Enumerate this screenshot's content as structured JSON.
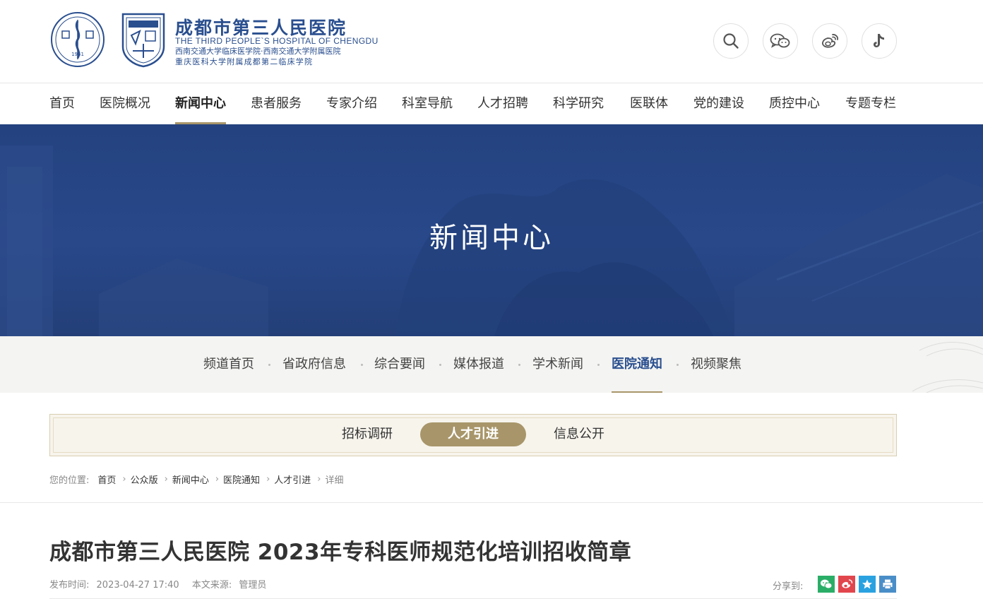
{
  "header": {
    "hospital_name_cn": "成都市第三人民医院",
    "hospital_name_en": "THE THIRD PEOPLE`S HOSPITAL OF CHENGDU",
    "affiliation_1": "西南交通大学临床医学院·西南交通大学附属医院",
    "affiliation_2": "重庆医科大学附属成都第二临床学院",
    "seal_year": "1941",
    "icons": [
      "search-icon",
      "wechat-icon",
      "weibo-icon",
      "tiktok-icon"
    ]
  },
  "nav": {
    "items": [
      "首页",
      "医院概况",
      "新闻中心",
      "患者服务",
      "专家介绍",
      "科室导航",
      "人才招聘",
      "科学研究",
      "医联体",
      "党的建设",
      "质控中心",
      "专题专栏"
    ],
    "active": "新闻中心"
  },
  "banner": {
    "title": "新闻中心"
  },
  "subnav": {
    "items": [
      "频道首页",
      "省政府信息",
      "综合要闻",
      "媒体报道",
      "学术新闻",
      "医院通知",
      "视频聚焦"
    ],
    "active": "医院通知"
  },
  "tabs": {
    "items": [
      "招标调研",
      "人才引进",
      "信息公开"
    ],
    "active": "人才引进"
  },
  "breadcrumb": {
    "label": "您的位置:",
    "items": [
      "首页",
      "公众版",
      "新闻中心",
      "医院通知",
      "人才引进",
      "详细"
    ]
  },
  "article": {
    "title": "成都市第三人民医院 2023年专科医师规范化培训招收简章",
    "publish_label": "发布时间:",
    "publish_time": "2023-04-27 17:40",
    "source_label": "本文来源:",
    "source": "管理员",
    "share_label": "分享到:",
    "share_icons": [
      "wechat-share-icon",
      "weibo-share-icon",
      "favorite-share-icon",
      "print-share-icon"
    ]
  },
  "colors": {
    "brand_blue": "#2a4f8f",
    "gold": "#a8966a",
    "banner_blue": "#26458a",
    "wechat_green": "#2aae67",
    "weibo_red": "#e2464d",
    "qzone_blue": "#2aa2e0",
    "print_blue": "#4a8ec8"
  }
}
